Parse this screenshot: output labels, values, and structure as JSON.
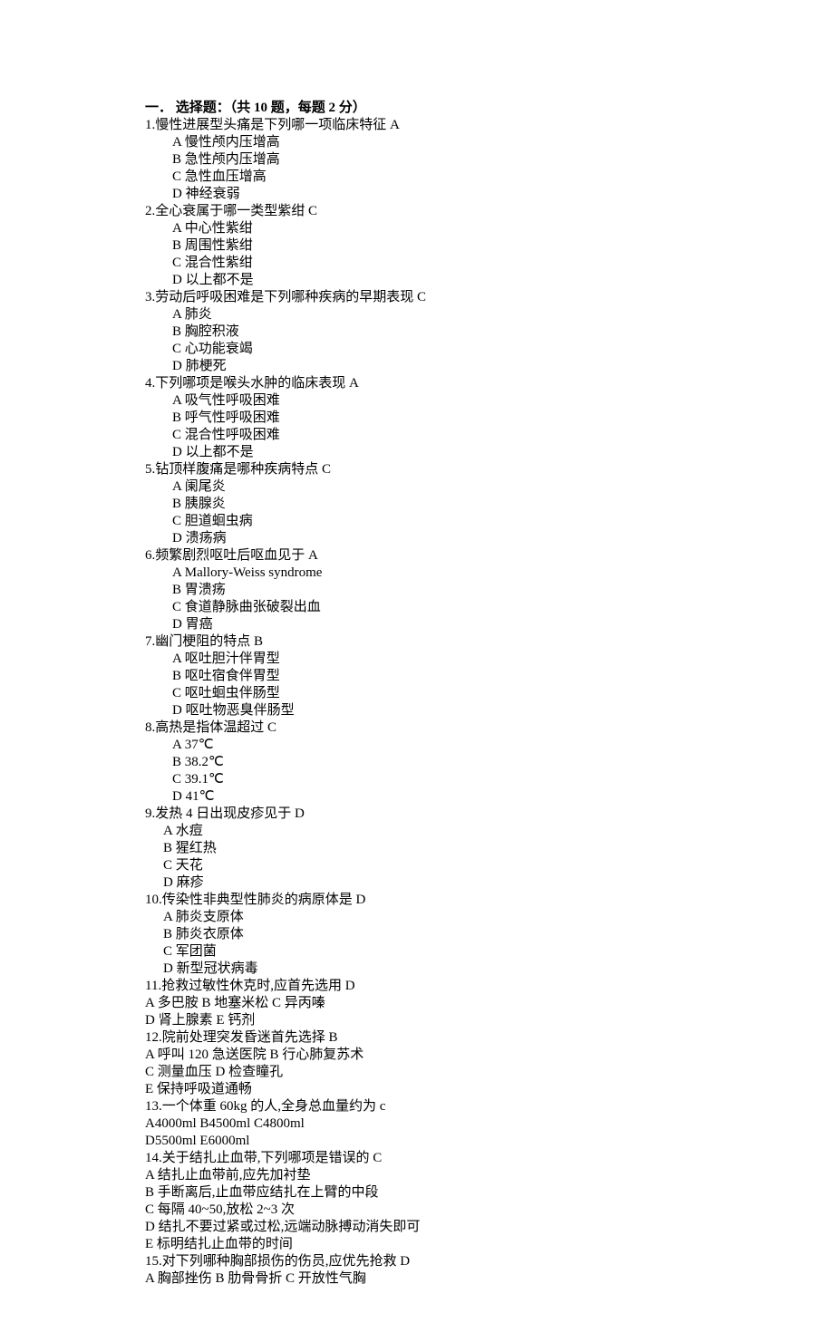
{
  "heading": "一．  选择题：（共 10 题，每题 2 分）",
  "q1": {
    "stem": "1.慢性进展型头痛是下列哪一项临床特征 A",
    "a": "A 慢性颅内压增高",
    "b": "B 急性颅内压增高",
    "c": "C 急性血压增高",
    "d": "D 神经衰弱"
  },
  "q2": {
    "stem": "2.全心衰属于哪一类型紫绀 C",
    "a": "A 中心性紫绀",
    "b": "B 周围性紫绀",
    "c": "C 混合性紫绀",
    "d": "D 以上都不是"
  },
  "q3": {
    "stem": "3.劳动后呼吸困难是下列哪种疾病的早期表现 C",
    "a": "A 肺炎",
    "b": "B 胸腔积液",
    "c": "C 心功能衰竭",
    "d": "D 肺梗死"
  },
  "q4": {
    "stem": "4.下列哪项是喉头水肿的临床表现 A",
    "a": "A 吸气性呼吸困难",
    "b": "B 呼气性呼吸困难",
    "c": "C 混合性呼吸困难",
    "d": "D 以上都不是"
  },
  "q5": {
    "stem": "5.钻顶样腹痛是哪种疾病特点 C",
    "a": "A 阑尾炎",
    "b": "B 胰腺炎",
    "c": "C 胆道蛔虫病",
    "d": "D 溃疡病"
  },
  "q6": {
    "stem": "6.频繁剧烈呕吐后呕血见于 A",
    "a": "A Mallory-Weiss syndrome",
    "b": "B 胃溃疡",
    "c": "C 食道静脉曲张破裂出血",
    "d": "D 胃癌"
  },
  "q7": {
    "stem": "7.幽门梗阻的特点 B",
    "a": "A 呕吐胆汁伴胃型",
    "b": "B 呕吐宿食伴胃型",
    "c": "C 呕吐蛔虫伴肠型",
    "d": "D 呕吐物恶臭伴肠型"
  },
  "q8": {
    "stem": "8.高热是指体温超过 C",
    "a": "A 37℃",
    "b": "B 38.2℃",
    "c": "C 39.1℃",
    "d": "D 41℃"
  },
  "q9": {
    "stem": "9.发热 4 日出现皮疹见于 D",
    "a": "A 水痘",
    "b": "B 猩红热",
    "c": "C 天花",
    "d": "D 麻疹"
  },
  "q10": {
    "stem": "10.传染性非典型性肺炎的病原体是 D",
    "a": "A 肺炎支原体",
    "b": "B 肺炎衣原体",
    "c": "C 军团菌",
    "d": "D 新型冠状病毒"
  },
  "q11": {
    "stem": "11.抢救过敏性休克时,应首先选用 D",
    "line1": "A 多巴胺    B 地塞米松    C 异丙嗪",
    "line2": "D 肾上腺素   E 钙剂"
  },
  "q12": {
    "stem": "12.院前处理突发昏迷首先选择 B",
    "line1": "A 呼叫 120 急送医院    B 行心肺复苏术",
    "line2": "C 测量血压        D 检查瞳孔",
    "line3": "E 保持呼吸道通畅"
  },
  "q13": {
    "stem": "13.一个体重 60kg 的人,全身总血量约为 c",
    "line1": "A4000ml   B4500ml   C4800ml",
    "line2": "D5500ml   E6000ml"
  },
  "q14": {
    "stem": "14.关于结扎止血带,下列哪项是错误的 C",
    "a": "A 结扎止血带前,应先加衬垫",
    "b": "B 手断离后,止血带应结扎在上臂的中段",
    "c": "C 每隔 40~50,放松 2~3 次",
    "d": "D 结扎不要过紧或过松,远端动脉搏动消失即可",
    "e": "E 标明结扎止血带的时间"
  },
  "q15": {
    "stem": "15.对下列哪种胸部损伤的伤员,应优先抢救 D",
    "line1": "A 胸部挫伤   B 肋骨骨折   C 开放性气胸"
  }
}
